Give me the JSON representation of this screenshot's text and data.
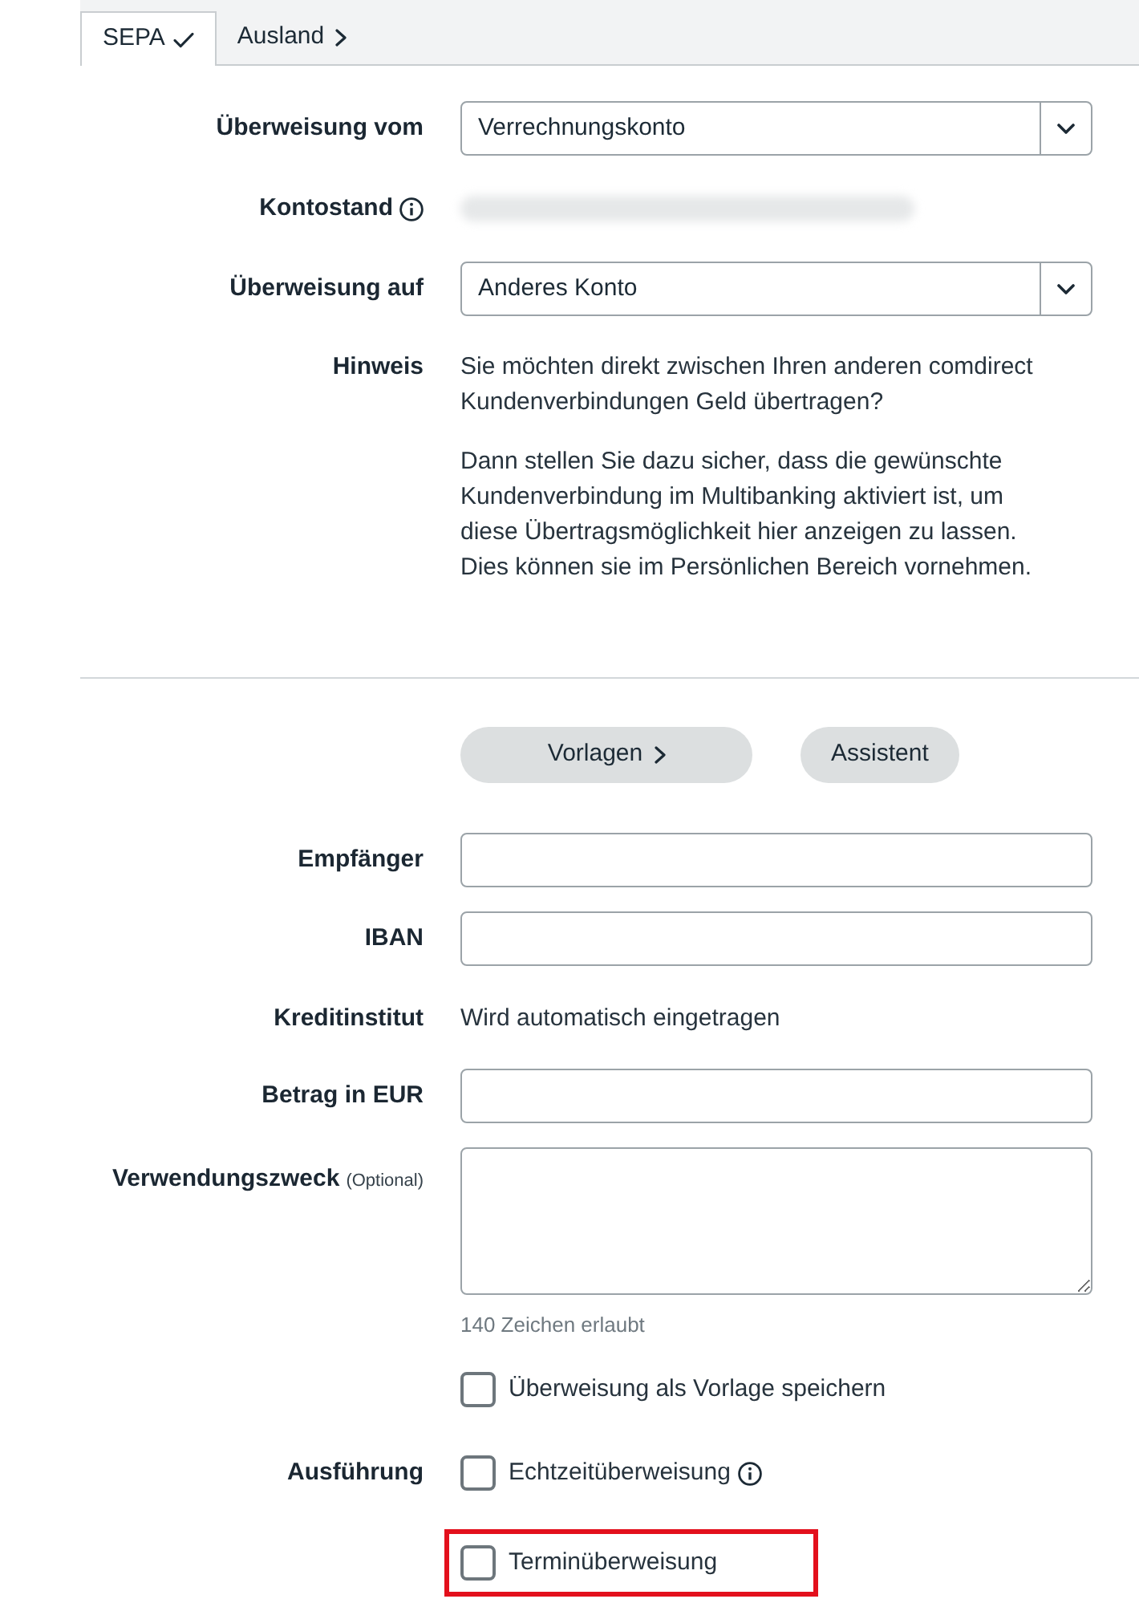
{
  "tabs": [
    {
      "label": "SEPA",
      "selected": true
    },
    {
      "label": "Ausland",
      "selected": false
    }
  ],
  "account_section": {
    "rows": [
      {
        "kind": "select",
        "label": "Überweisung vom",
        "value": "Verrechnungskonto"
      },
      {
        "kind": "balance",
        "label": "Kontostand",
        "info": true
      },
      {
        "kind": "select",
        "label": "Überweisung auf",
        "value": "Anderes Konto"
      },
      {
        "kind": "note",
        "label": "Hinweis",
        "paragraphs": [
          "Sie möchten direkt zwischen Ihren anderen comdirect Kundenverbindungen Geld übertragen?",
          "Dann stellen Sie dazu sicher, dass die gewünschte Kundenverbindung im Multibanking aktiviert ist, um diese Übertragsmöglichkeit hier anzeigen zu lassen. Dies können sie im Persönlichen Bereich vornehmen."
        ]
      }
    ]
  },
  "payment_section": {
    "buttons": [
      {
        "label": "Vorlagen",
        "chevron": true
      },
      {
        "label": "Assistent",
        "chevron": false
      }
    ],
    "rows": [
      {
        "kind": "input",
        "label": "Empfänger"
      },
      {
        "kind": "input",
        "label": "IBAN"
      },
      {
        "kind": "text",
        "label": "Kreditinstitut",
        "value": "Wird automatisch eingetragen"
      },
      {
        "kind": "input",
        "label": "Betrag in EUR"
      },
      {
        "kind": "textarea",
        "label": "Verwendungszweck",
        "label_note": "(Optional)",
        "hint": "140 Zeichen erlaubt"
      },
      {
        "kind": "checkbox",
        "options": [
          {
            "label": "Überweisung als Vorlage speichern",
            "checked": false,
            "info": false,
            "highlighted": false
          }
        ]
      },
      {
        "kind": "checkbox",
        "label": "Ausführung",
        "options": [
          {
            "label": "Echtzeitüberweisung",
            "checked": false,
            "info": true,
            "highlighted": false
          },
          {
            "label": "Terminüberweisung",
            "checked": false,
            "info": false,
            "highlighted": true
          }
        ]
      }
    ]
  }
}
